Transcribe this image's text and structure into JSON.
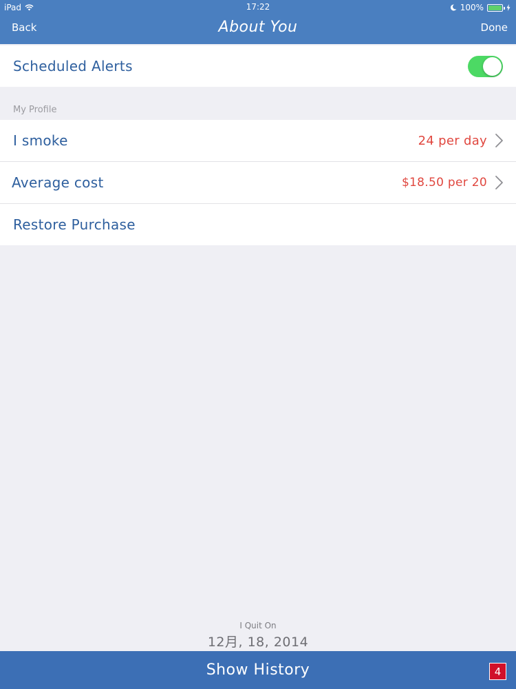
{
  "status_bar": {
    "device": "iPad",
    "time": "17:22",
    "battery": "100%",
    "battery_level": 1.0
  },
  "nav": {
    "back_label": "Back",
    "title": "About You",
    "done_label": "Done"
  },
  "alerts": {
    "label": "Scheduled Alerts",
    "enabled": true
  },
  "profile": {
    "section_title": "My Profile",
    "smoke_label": "I smoke",
    "smoke_value": "24 per day",
    "cost_label": "Average cost",
    "cost_value": "$18.50 per 20",
    "restore_label": "Restore Purchase"
  },
  "quit": {
    "label": "I Quit On",
    "date": "12月, 18, 2014"
  },
  "bottom": {
    "label": "Show History",
    "badge": "4"
  },
  "colors": {
    "nav_bar": "#4a7fc0",
    "bottom_bar": "#3c6fb5",
    "label_text": "#2e5f9e",
    "value_text": "#e0473f",
    "toggle_on": "#4cd964",
    "badge": "#d0102a"
  },
  "icons": [
    "wifi-icon",
    "moon-icon",
    "battery-icon",
    "charging-icon",
    "chevron-right-icon"
  ]
}
